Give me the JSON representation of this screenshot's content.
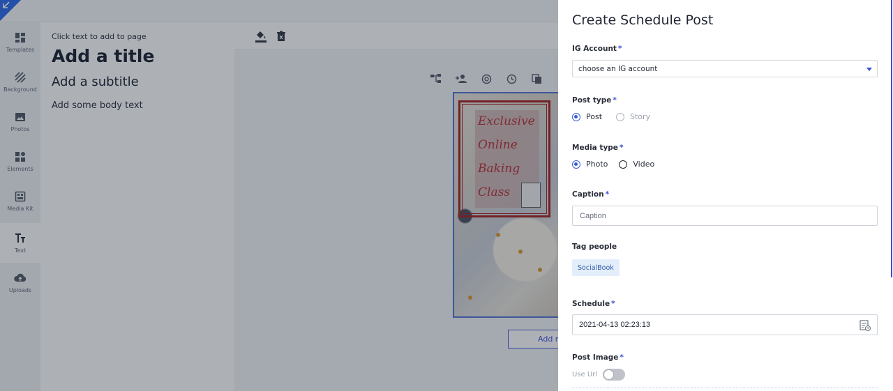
{
  "rail": {
    "items": [
      {
        "label": "Templates",
        "icon": "templates-icon"
      },
      {
        "label": "Background",
        "icon": "background-icon"
      },
      {
        "label": "Photos",
        "icon": "photos-icon"
      },
      {
        "label": "Elements",
        "icon": "elements-icon"
      },
      {
        "label": "Media Kit",
        "icon": "media-kit-icon"
      },
      {
        "label": "Text",
        "icon": "text-icon",
        "active": true
      },
      {
        "label": "Uploads",
        "icon": "uploads-icon"
      }
    ]
  },
  "text_panel": {
    "hint": "Click text to add to page",
    "title": "Add a title",
    "subtitle": "Add a subtitle",
    "body": "Add some body text"
  },
  "canvas": {
    "words": [
      "Exclusive",
      "Online",
      "Baking",
      "Class"
    ]
  },
  "workspace": {
    "add_page_label": "Add n"
  },
  "sheet": {
    "title": "Create Schedule Post",
    "ig_account": {
      "label": "IG Account",
      "value": "choose an IG account"
    },
    "post_type": {
      "label": "Post type",
      "options": [
        "Post",
        "Story"
      ],
      "selected": "Post"
    },
    "media_type": {
      "label": "Media type",
      "options": [
        "Photo",
        "Video"
      ],
      "selected": "Photo"
    },
    "caption": {
      "label": "Caption",
      "placeholder": "Caption"
    },
    "tag_people": {
      "label": "Tag people",
      "chip": "SocialBook"
    },
    "schedule": {
      "label": "Schedule",
      "value": "2021-04-13 02:23:13"
    },
    "post_image": {
      "label": "Post Image",
      "toggle_label": "Use Url",
      "enabled": false
    },
    "required_mark": "*"
  },
  "colors": {
    "accent": "#3b4fd8",
    "radio_selected": "#3b5bdb",
    "chip_bg": "#e3eefb",
    "overlay": "rgba(40,50,62,0.38)"
  }
}
